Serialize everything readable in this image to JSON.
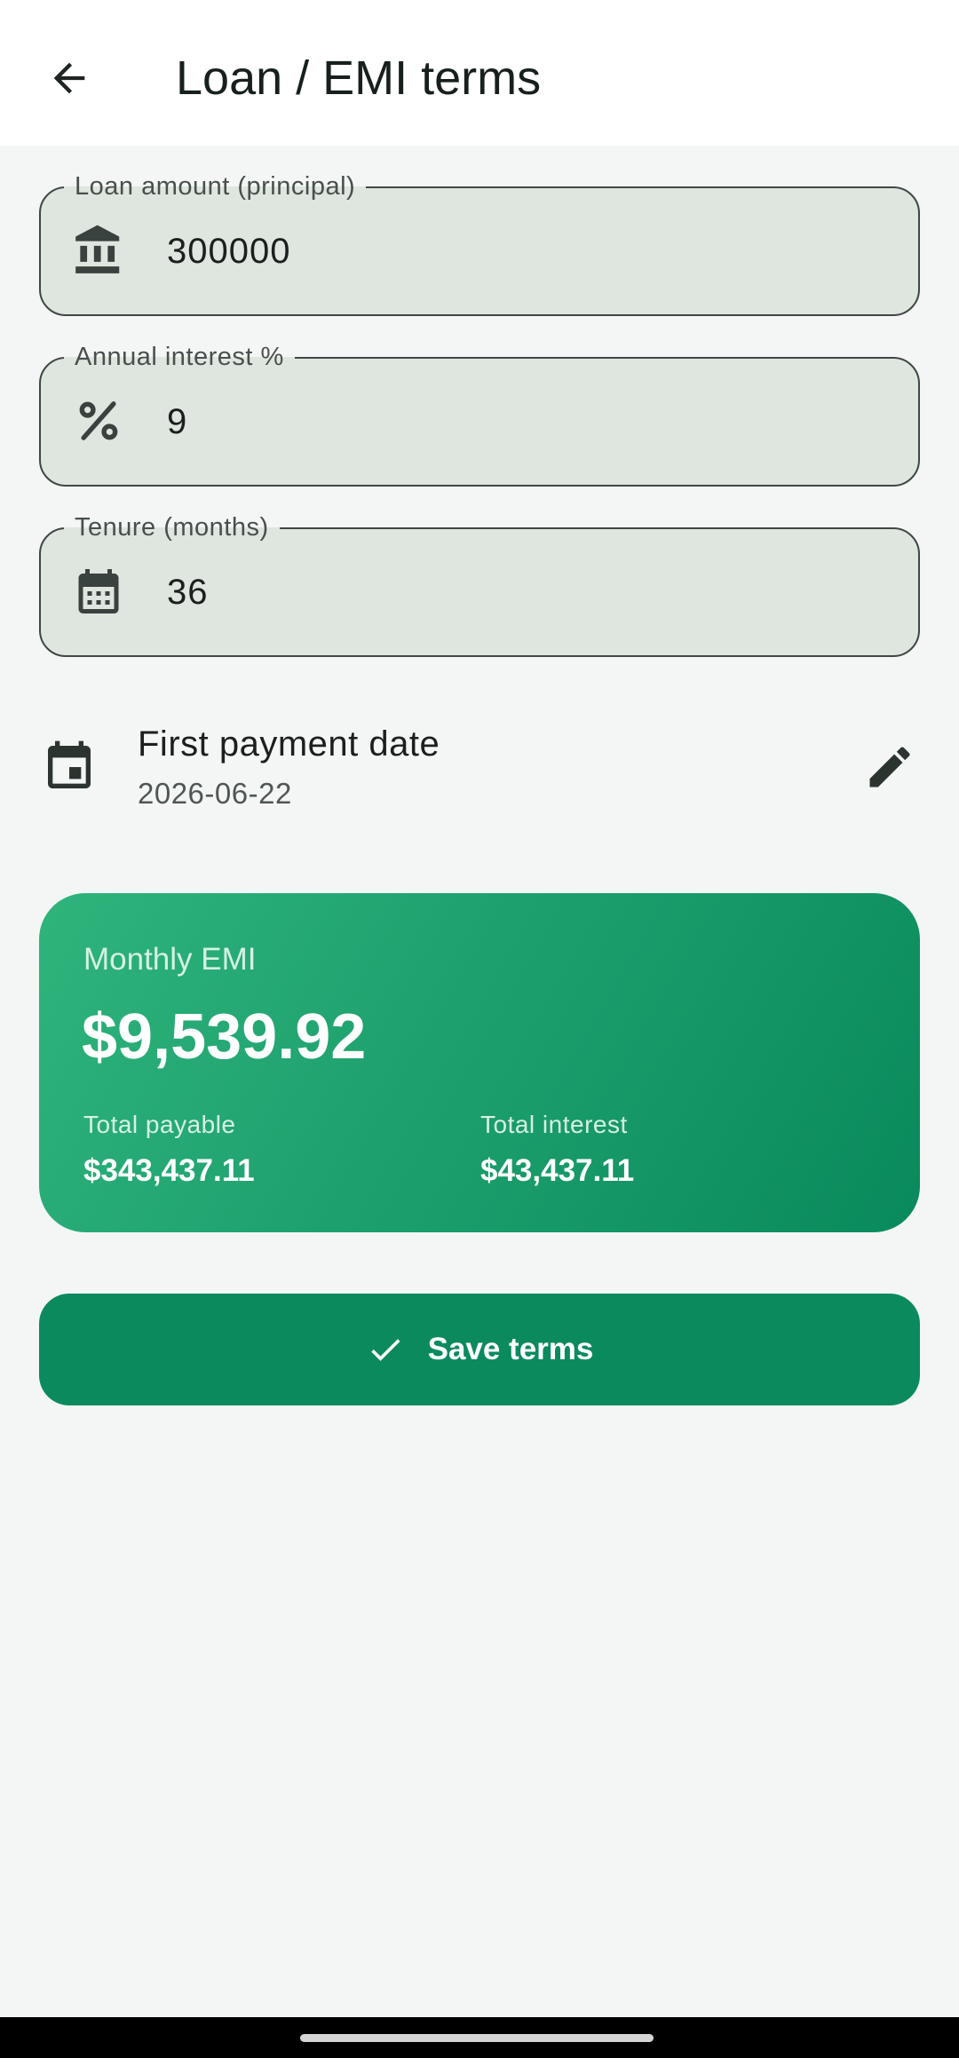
{
  "app_bar": {
    "title": "Loan / EMI terms",
    "back_icon": "arrow-back-icon"
  },
  "fields": {
    "principal": {
      "label": "Loan amount (principal)",
      "value": "300000",
      "icon": "bank-icon"
    },
    "interest": {
      "label": "Annual interest %",
      "value": "9",
      "icon": "percent-icon"
    },
    "tenure": {
      "label": "Tenure (months)",
      "value": "36",
      "icon": "calendar-month-icon"
    }
  },
  "first_payment": {
    "title": "First payment date",
    "value": "2026-06-22",
    "icon": "event-icon",
    "edit_icon": "pencil-icon"
  },
  "summary": {
    "monthly_label": "Monthly EMI",
    "monthly_value": "$9,539.92",
    "total_payable_label": "Total payable",
    "total_payable_value": "$343,437.11",
    "total_interest_label": "Total interest",
    "total_interest_value": "$43,437.11"
  },
  "actions": {
    "save_label": "Save terms",
    "save_icon": "check-icon"
  },
  "colors": {
    "accent": "#0b8a5e",
    "card_gradient_start": "#2fb47c",
    "card_gradient_end": "#0a8a5c",
    "field_fill": "#dfe5df",
    "background": "#f4f6f5"
  }
}
